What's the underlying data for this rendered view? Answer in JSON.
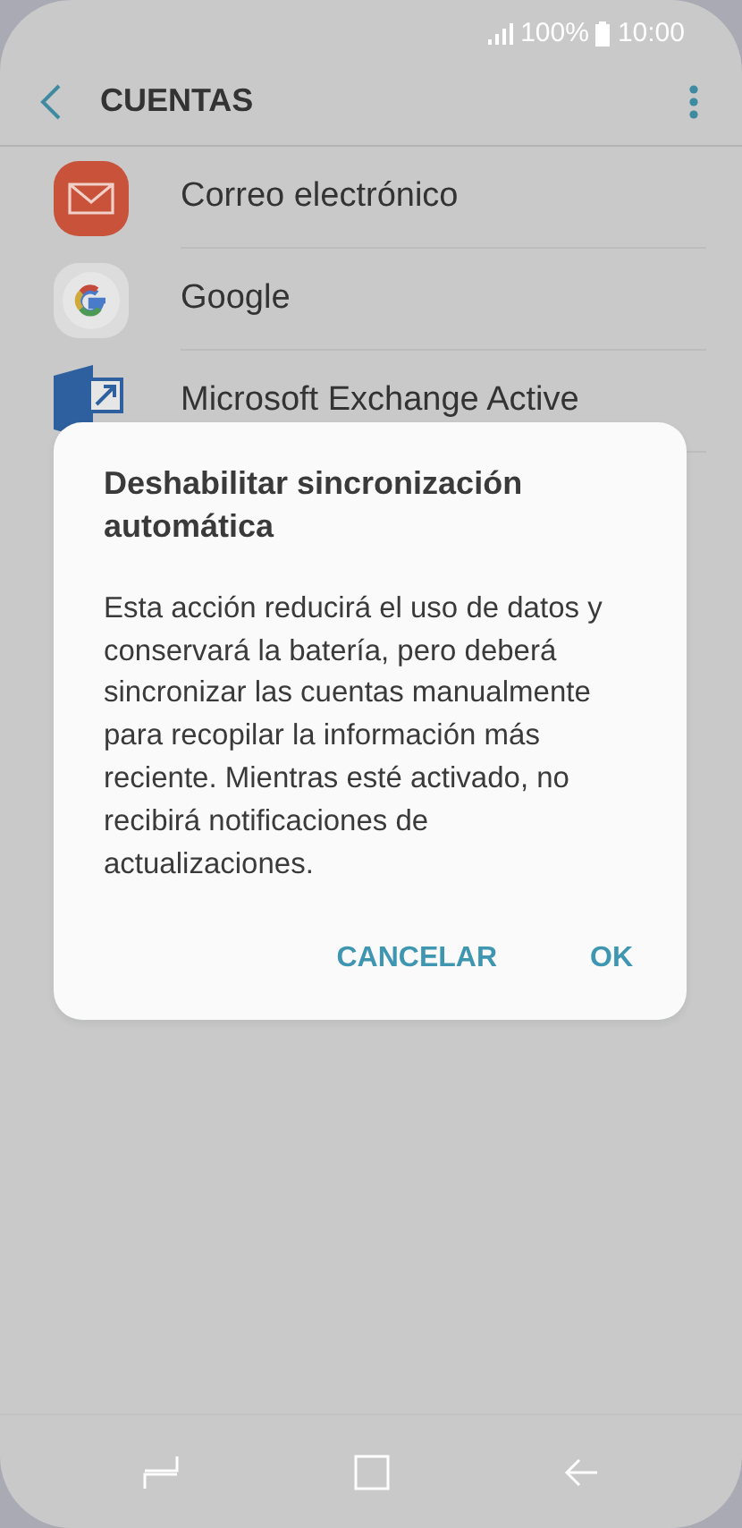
{
  "status_bar": {
    "battery": "100%",
    "time": "10:00"
  },
  "header": {
    "title": "CUENTAS"
  },
  "accounts": [
    {
      "name": "Correo electrónico",
      "kind": "email"
    },
    {
      "name": "Google",
      "kind": "google"
    },
    {
      "name": "Microsoft Exchange Active",
      "kind": "exchange"
    }
  ],
  "dialog": {
    "title": "Deshabilitar sincronización automática",
    "message": "Esta acción reducirá el uso de datos y conservará la batería, pero deberá sincronizar las cuentas manualmente para recopilar la información más reciente. Mientras esté activado, no recibirá notificaciones de actualizaciones.",
    "buttons": [
      "CANCELAR",
      "OK"
    ]
  }
}
